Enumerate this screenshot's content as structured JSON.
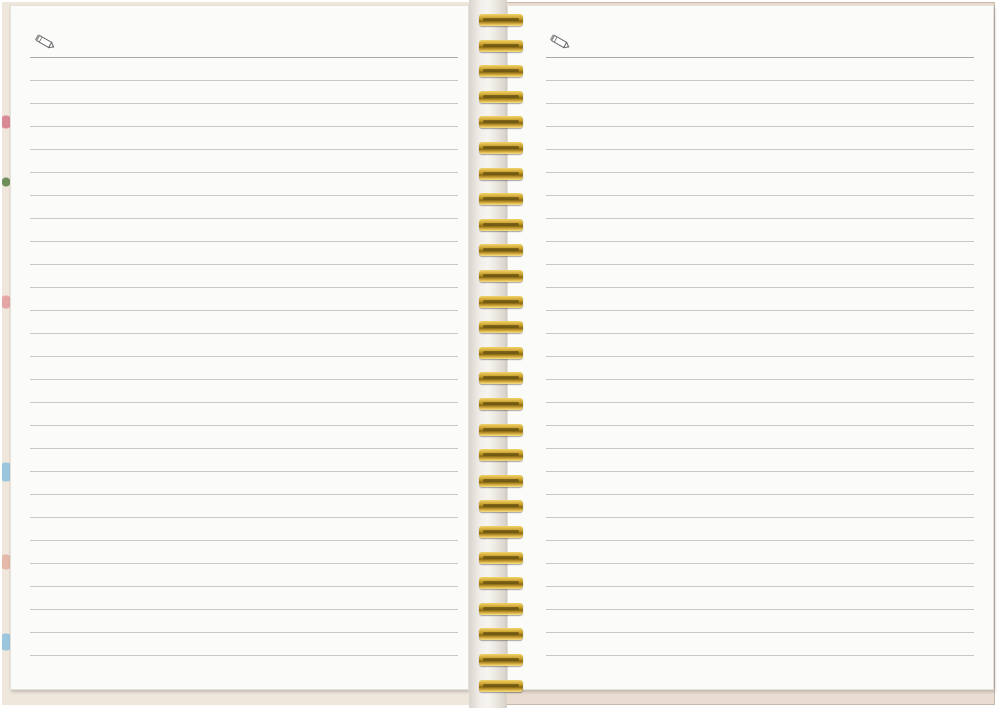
{
  "notebook": {
    "left_page": {
      "icon": "pencil-icon",
      "ruled_line_count": 27
    },
    "right_page": {
      "icon": "pencil-icon",
      "ruled_line_count": 27
    },
    "binding": {
      "type": "spiral",
      "ring_count": 27,
      "ring_color": "#caa12b"
    },
    "colors": {
      "paper": "#fbfbf9",
      "rule": "#c8c8c6",
      "cover": "#efe6dc"
    }
  }
}
